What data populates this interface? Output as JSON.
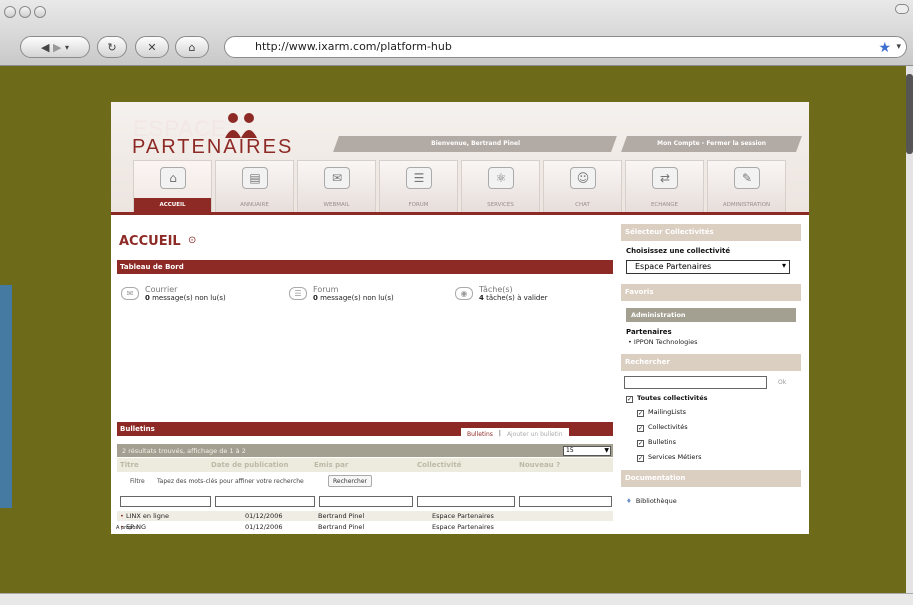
{
  "browser": {
    "url": "http://www.ixarm.com/platform-hub"
  },
  "header": {
    "logo_line1": "ESPACE",
    "logo_line2": "PARTENAIRES",
    "welcome": "Bienvenue, Bertrand Pinel",
    "account": "Mon Compte - Fermer la session"
  },
  "tabs": [
    {
      "label": "ACCUEIL",
      "icon": "home-icon",
      "active": true
    },
    {
      "label": "ANNUAIRE",
      "icon": "book-icon",
      "active": false
    },
    {
      "label": "WEBMAIL",
      "icon": "mail-icon",
      "active": false
    },
    {
      "label": "FORUM",
      "icon": "speech-bubble-icon",
      "active": false
    },
    {
      "label": "SERVICES",
      "icon": "atom-icon",
      "active": false
    },
    {
      "label": "CHAT",
      "icon": "chat-icon",
      "active": false
    },
    {
      "label": "ECHANGE",
      "icon": "exchange-icon",
      "active": false
    },
    {
      "label": "ADMINISTRATION",
      "icon": "tools-icon",
      "active": false
    }
  ],
  "main": {
    "title": "ACCUEIL",
    "dashboard": {
      "title": "Tableau de Bord",
      "items": [
        {
          "label": "Courrier",
          "count": "0",
          "text": "message(s) non lu(s)"
        },
        {
          "label": "Forum",
          "count": "0",
          "text": "message(s) non lu(s)"
        },
        {
          "label": "Tâche(s)",
          "count": "4",
          "text": "tâche(s) à valider"
        }
      ]
    },
    "bulletins": {
      "title": "Bulletins",
      "tab_active": "Bulletins",
      "tab_add": "Ajouter un bulletin",
      "results": "2 résultats trouvés, affichage de 1 à 2",
      "page_size": "15",
      "columns": [
        "Titre",
        "Date de publication",
        "Emis par",
        "Collectivité",
        "Nouveau ?"
      ],
      "filter_label": "Filtre",
      "filter_hint": "Tapez des mots-clés pour affiner votre recherche",
      "filter_button": "Rechercher",
      "rows": [
        {
          "titre": "LINX en ligne",
          "date": "01/12/2006",
          "emis": "Bertrand Pinel",
          "coll": "Espace Partenaires"
        },
        {
          "titre": "EP NG",
          "date": "01/12/2006",
          "emis": "Bertrand Pinel",
          "coll": "Espace Partenaires"
        }
      ]
    },
    "footer": "A propos"
  },
  "sidebar": {
    "selector_title": "Sélecteur Collectivités",
    "choose_label": "Choisissez une collectivité",
    "selected": "Espace Partenaires",
    "favorites_title": "Favoris",
    "admin_label": "Administration",
    "partners_label": "Partenaires",
    "partner_item": "IPPON Technologies",
    "search_title": "Rechercher",
    "ok_label": "Ok",
    "checks": [
      {
        "label": "Toutes collectivités",
        "checked": true
      },
      {
        "label": "MailingLists",
        "checked": true
      },
      {
        "label": "Collectivités",
        "checked": true
      },
      {
        "label": "Bulletins",
        "checked": true
      },
      {
        "label": "Services Métiers",
        "checked": true
      }
    ],
    "doc_title": "Documentation",
    "library": "Bibliothèque"
  },
  "colors": {
    "brand": "#8e2a25",
    "background": "#6d6a1a",
    "sidebar_header": "#dbcfc2"
  }
}
